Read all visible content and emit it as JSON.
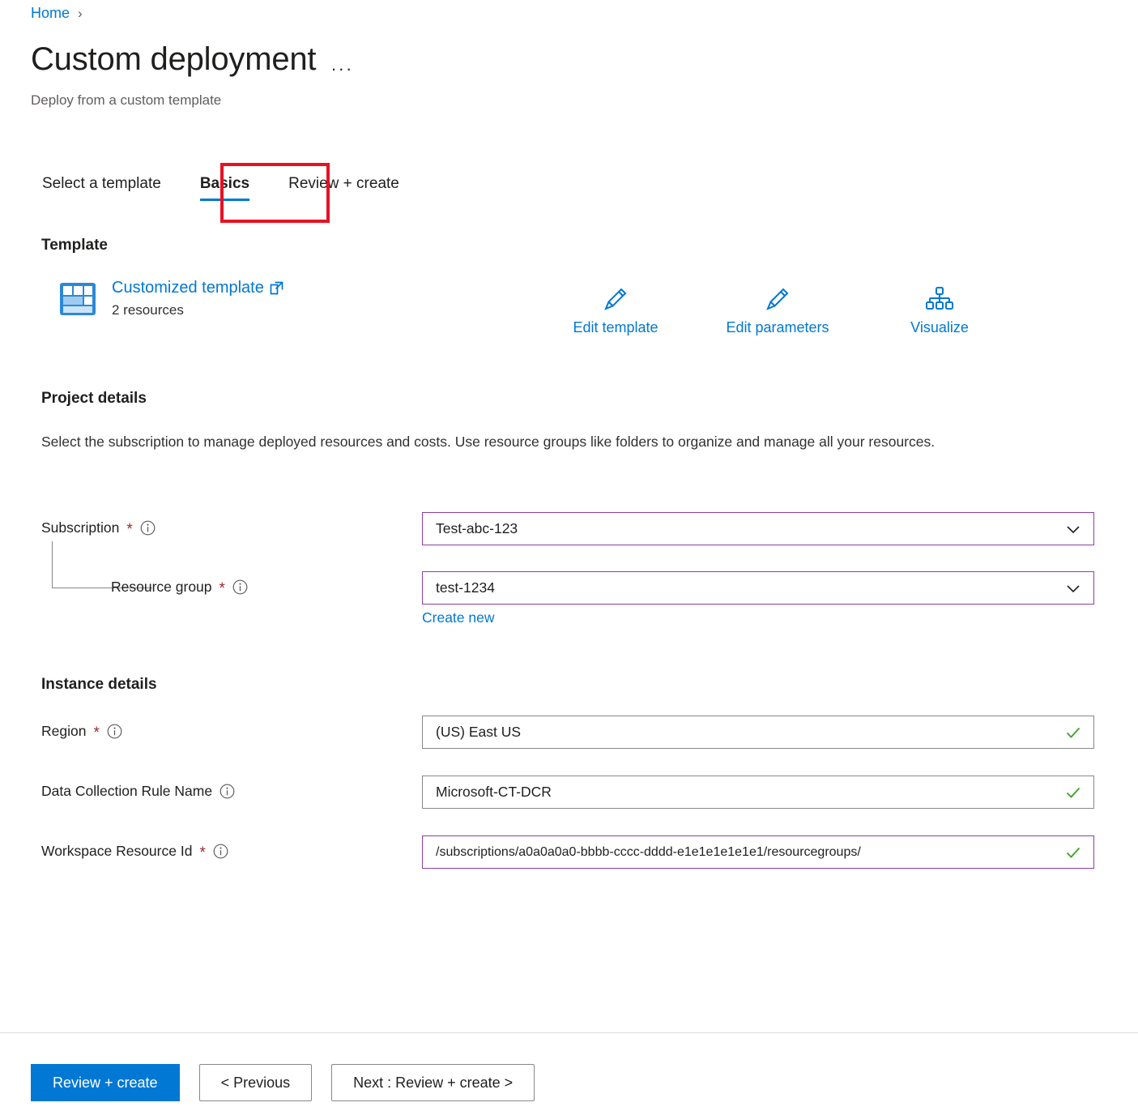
{
  "breadcrumb": {
    "home": "Home",
    "separator": "›"
  },
  "header": {
    "title": "Custom deployment",
    "subtitle": "Deploy from a custom template",
    "more_label": "···"
  },
  "tabs": [
    {
      "label": "Select a template",
      "active": false
    },
    {
      "label": "Basics",
      "active": true
    },
    {
      "label": "Review + create",
      "active": false
    }
  ],
  "template": {
    "heading": "Template",
    "link_label": "Customized template",
    "resources_label": "2 resources",
    "actions": [
      {
        "label": "Edit template",
        "icon": "pencil-icon"
      },
      {
        "label": "Edit parameters",
        "icon": "pencil-icon"
      },
      {
        "label": "Visualize",
        "icon": "hierarchy-icon"
      }
    ]
  },
  "project_details": {
    "heading": "Project details",
    "description": "Select the subscription to manage deployed resources and costs. Use resource groups like folders to organize and manage all your resources.",
    "subscription": {
      "label": "Subscription",
      "required": "*",
      "value": "Test-abc-123"
    },
    "resource_group": {
      "label": "Resource group",
      "required": "*",
      "value": "test-1234",
      "create_new_label": "Create new"
    }
  },
  "instance_details": {
    "heading": "Instance details",
    "region": {
      "label": "Region",
      "required": "*",
      "value": "(US) East US"
    },
    "dcr_name": {
      "label": "Data Collection Rule Name",
      "value": "Microsoft-CT-DCR"
    },
    "workspace_resource_id": {
      "label": "Workspace Resource Id",
      "required": "*",
      "value": "/subscriptions/a0a0a0a0-bbbb-cccc-dddd-e1e1e1e1e1e1/resourcegroups/"
    }
  },
  "footer": {
    "review_create": "Review + create",
    "previous": "< Previous",
    "next": "Next : Review + create >"
  },
  "colors": {
    "accent_blue": "#0078d4",
    "required_red": "#a4262c",
    "highlight_red": "#e81123",
    "focus_purple": "#8c3fa6",
    "valid_green": "#3fa42c",
    "border_grey": "#8a8886"
  }
}
